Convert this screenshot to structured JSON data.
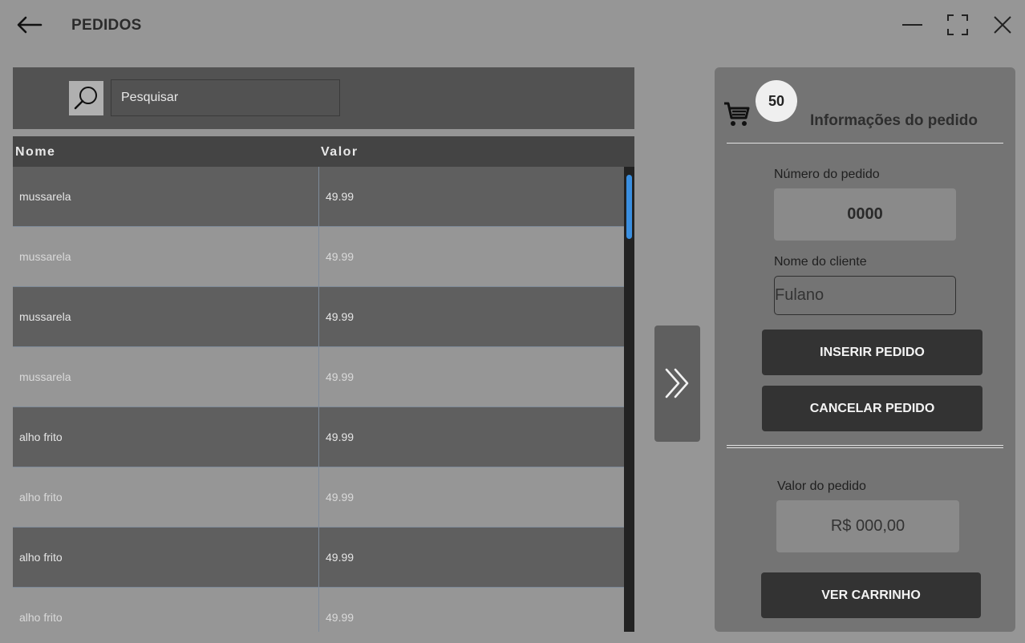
{
  "header": {
    "title": "PEDIDOS",
    "back_icon": "arrow-left-icon",
    "window_controls": [
      "minimize-icon",
      "maximize-icon",
      "close-icon"
    ]
  },
  "search": {
    "placeholder": "Pesquisar",
    "icon": "search-icon"
  },
  "table": {
    "columns": [
      "Nome",
      "Valor"
    ],
    "rows": [
      {
        "name": "mussarela",
        "value": "49.99"
      },
      {
        "name": "mussarela",
        "value": "49.99"
      },
      {
        "name": "mussarela",
        "value": "49.99"
      },
      {
        "name": "mussarela",
        "value": "49.99"
      },
      {
        "name": "alho frito",
        "value": "49.99"
      },
      {
        "name": "alho frito",
        "value": "49.99"
      },
      {
        "name": "alho frito",
        "value": "49.99"
      },
      {
        "name": "alho frito",
        "value": "49.99"
      }
    ]
  },
  "move_button": {
    "icon": "double-chevron-right-icon"
  },
  "panel": {
    "cart_icon": "cart-icon",
    "cart_count": "50",
    "title": "Informações do pedido",
    "order_number_label": "Número do pedido",
    "order_number": "0000",
    "client_name_label": "Nome do cliente",
    "client_name": "Fulano",
    "insert_button": "INSERIR PEDIDO",
    "cancel_button": "CANCELAR PEDIDO",
    "order_value_label": "Valor do pedido",
    "order_value": "R$ 000,00",
    "view_cart_button": "VER CARRINHO"
  },
  "colors": {
    "background": "#969696",
    "dark_row": "#5f5f5f",
    "button_dark": "#333333",
    "scroll_thumb": "#3a8fe0"
  }
}
